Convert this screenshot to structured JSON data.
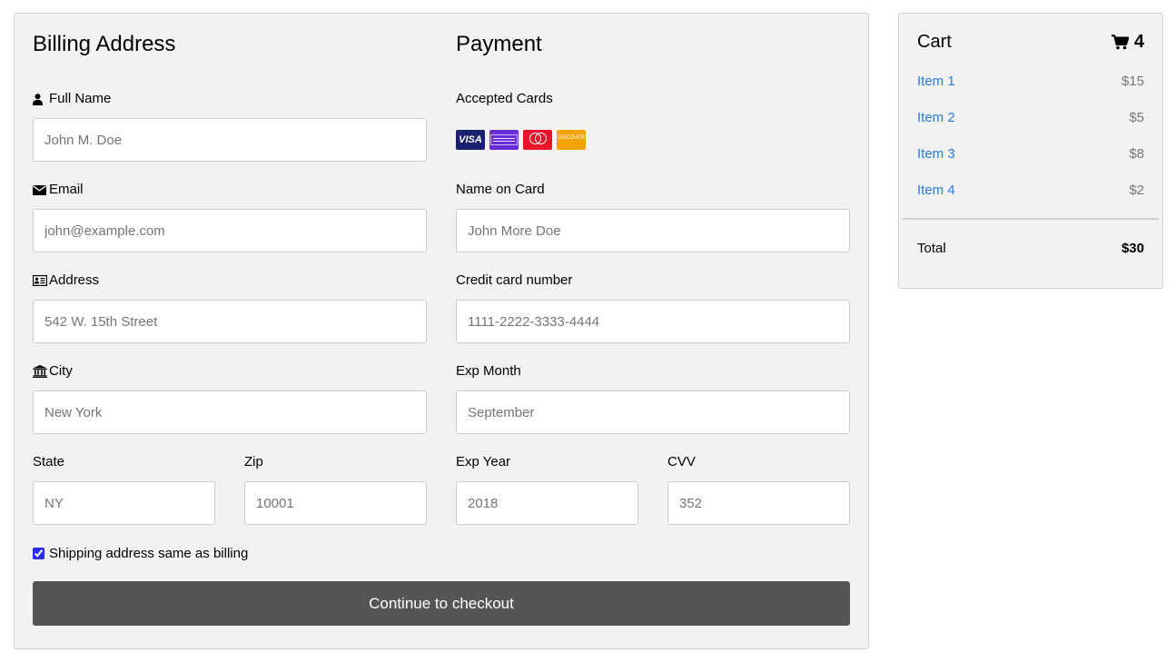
{
  "billing": {
    "title": "Billing Address",
    "full_name": {
      "label": "Full Name",
      "placeholder": "John M. Doe",
      "icon": "user-icon"
    },
    "email": {
      "label": "Email",
      "placeholder": "john@example.com",
      "icon": "envelope-icon"
    },
    "address": {
      "label": "Address",
      "placeholder": "542 W. 15th Street",
      "icon": "address-card-icon"
    },
    "city": {
      "label": "City",
      "placeholder": "New York",
      "icon": "institution-icon"
    },
    "state": {
      "label": "State",
      "placeholder": "NY"
    },
    "zip": {
      "label": "Zip",
      "placeholder": "10001"
    }
  },
  "payment": {
    "title": "Payment",
    "accepted_cards_label": "Accepted Cards",
    "cards": [
      {
        "name": "visa",
        "text": "VISA",
        "color": "#1a1f71"
      },
      {
        "name": "amex",
        "color": "#6a2bd9"
      },
      {
        "name": "mastercard",
        "color": "#e8142a"
      },
      {
        "name": "discover",
        "text": "DISCOVER",
        "color": "#f5a300"
      }
    ],
    "name_on_card": {
      "label": "Name on Card",
      "placeholder": "John More Doe"
    },
    "card_number": {
      "label": "Credit card number",
      "placeholder": "1111-2222-3333-4444"
    },
    "exp_month": {
      "label": "Exp Month",
      "placeholder": "September"
    },
    "exp_year": {
      "label": "Exp Year",
      "placeholder": "2018"
    },
    "cvv": {
      "label": "CVV",
      "placeholder": "352"
    }
  },
  "shipping_same": {
    "label": "Shipping address same as billing",
    "checked": true
  },
  "checkout_button": {
    "label": "Continue to checkout",
    "color": "#555555"
  },
  "cart": {
    "title": "Cart",
    "count": "4",
    "icon": "shopping-cart-icon",
    "items": [
      {
        "name": "Item 1",
        "price": "$15"
      },
      {
        "name": "Item 2",
        "price": "$5"
      },
      {
        "name": "Item 3",
        "price": "$8"
      },
      {
        "name": "Item 4",
        "price": "$2"
      }
    ],
    "total_label": "Total",
    "total_value": "$30",
    "link_color": "#2a7ae2"
  }
}
